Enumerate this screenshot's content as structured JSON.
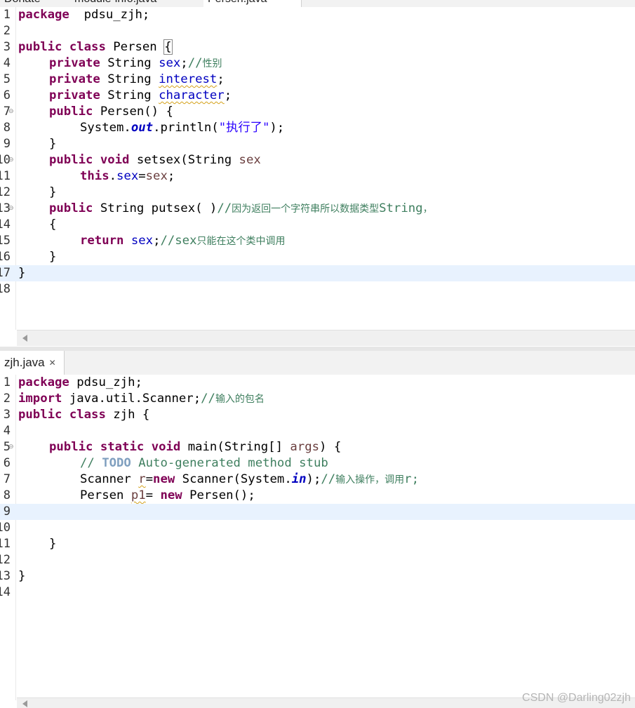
{
  "top_tabs": [
    "Donate",
    "module-info.java",
    "Persen.java"
  ],
  "pane1": {
    "lines": [
      {
        "n": "1",
        "segs": [
          [
            "kw",
            "package"
          ],
          [
            "",
            "  pdsu_zjh;"
          ]
        ]
      },
      {
        "n": "2",
        "segs": []
      },
      {
        "n": "3",
        "segs": [
          [
            "kw",
            "public"
          ],
          [
            "",
            " "
          ],
          [
            "kw",
            "class"
          ],
          [
            "",
            " Persen "
          ],
          [
            "box",
            "{"
          ]
        ]
      },
      {
        "n": "4",
        "segs": [
          [
            "",
            " "
          ],
          [
            "kw",
            "private"
          ],
          [
            "",
            " String "
          ],
          [
            "fld",
            "sex"
          ],
          [
            "",
            ";"
          ],
          [
            "cmt",
            "//"
          ],
          [
            "cmtcjk",
            "性别"
          ]
        ]
      },
      {
        "n": "5",
        "segs": [
          [
            "",
            " "
          ],
          [
            "kw",
            "private"
          ],
          [
            "",
            " String "
          ],
          [
            "fldw",
            "interest"
          ],
          [
            "",
            ";"
          ]
        ]
      },
      {
        "n": "6",
        "segs": [
          [
            "",
            " "
          ],
          [
            "kw",
            "private"
          ],
          [
            "",
            " String "
          ],
          [
            "fldw",
            "character"
          ],
          [
            "",
            ";"
          ]
        ]
      },
      {
        "n": "7",
        "fold": true,
        "segs": [
          [
            "",
            " "
          ],
          [
            "kw",
            "public"
          ],
          [
            "",
            " Persen() {"
          ]
        ]
      },
      {
        "n": "8",
        "segs": [
          [
            "",
            " System."
          ],
          [
            "sfld",
            "out"
          ],
          [
            "",
            ".println("
          ],
          [
            "str",
            "\"执行了\""
          ],
          [
            "",
            ");"
          ]
        ]
      },
      {
        "n": "9",
        "segs": [
          [
            "",
            " }"
          ]
        ]
      },
      {
        "n": "10",
        "fold": true,
        "segs": [
          [
            "",
            " "
          ],
          [
            "kw",
            "public"
          ],
          [
            "",
            " "
          ],
          [
            "kw",
            "void"
          ],
          [
            "",
            " setsex(String "
          ],
          [
            "var",
            "sex"
          ],
          [
            ") {"
          ]
        ]
      },
      {
        "n": "11",
        "segs": [
          [
            "",
            " "
          ],
          [
            "kw",
            "this"
          ],
          [
            "",
            "."
          ],
          [
            "fld",
            "sex"
          ],
          [
            "",
            "="
          ],
          [
            "var",
            "sex"
          ],
          [
            "",
            ";"
          ]
        ]
      },
      {
        "n": "12",
        "segs": [
          [
            "",
            " }"
          ]
        ]
      },
      {
        "n": "13",
        "fold": true,
        "segs": [
          [
            "",
            " "
          ],
          [
            "kw",
            "public"
          ],
          [
            "",
            " String putsex( )"
          ],
          [
            "cmt",
            "//"
          ],
          [
            "cmtcjk",
            "因为返回一个字符串所以数据类型"
          ],
          [
            "cmt",
            "String"
          ],
          [
            "cmtcjk",
            "，"
          ]
        ]
      },
      {
        "n": "14",
        "segs": [
          [
            "",
            " {"
          ]
        ]
      },
      {
        "n": "15",
        "segs": [
          [
            "",
            " "
          ],
          [
            "kw",
            "return"
          ],
          [
            "",
            " "
          ],
          [
            "fld",
            "sex"
          ],
          [
            "",
            ";"
          ],
          [
            "cmt",
            "//sex"
          ],
          [
            "cmtcjk",
            "只能在这个类中调用"
          ]
        ]
      },
      {
        "n": "16",
        "segs": [
          [
            "",
            " }"
          ]
        ]
      },
      {
        "n": "17",
        "current": true,
        "segs": [
          [
            "",
            "}"
          ]
        ]
      },
      {
        "n": "18",
        "segs": []
      }
    ]
  },
  "pane2": {
    "tab_label": "zjh.java",
    "close_glyph": "✕",
    "lines": [
      {
        "n": "1",
        "segs": [
          [
            "kw",
            "package"
          ],
          [
            "",
            " pdsu_zjh;"
          ]
        ]
      },
      {
        "n": "2",
        "segs": [
          [
            "kw",
            "import"
          ],
          [
            "",
            " java.util.Scanner;"
          ],
          [
            "cmt",
            "//"
          ],
          [
            "cmtcjk",
            "输入的包名"
          ]
        ]
      },
      {
        "n": "3",
        "segs": [
          [
            "kw",
            "public"
          ],
          [
            "",
            " "
          ],
          [
            "kw",
            "class"
          ],
          [
            "",
            " zjh {"
          ]
        ]
      },
      {
        "n": "4",
        "segs": []
      },
      {
        "n": "5",
        "fold": true,
        "segs": [
          [
            "",
            " "
          ],
          [
            "kw",
            "public"
          ],
          [
            "",
            " "
          ],
          [
            "kw",
            "static"
          ],
          [
            "",
            " "
          ],
          [
            "kw",
            "void"
          ],
          [
            "",
            " main(String[] "
          ],
          [
            "var",
            "args"
          ],
          [
            "",
            ") {"
          ]
        ]
      },
      {
        "n": "6",
        "segs": [
          [
            "",
            " "
          ],
          [
            "cmt",
            "// "
          ],
          [
            "todo",
            "TODO"
          ],
          [
            "cmt",
            " Auto-generated method stub"
          ]
        ]
      },
      {
        "n": "7",
        "segs": [
          [
            "",
            " Scanner "
          ],
          [
            "varw",
            "r"
          ],
          [
            "",
            "="
          ],
          [
            "kw",
            "new"
          ],
          [
            "",
            " Scanner(System."
          ],
          [
            "sfld",
            "in"
          ],
          [
            "",
            ");"
          ],
          [
            "cmt",
            "//"
          ],
          [
            "cmtcjk",
            "输入操作，调用"
          ],
          [
            "cmt",
            "r;"
          ]
        ]
      },
      {
        "n": "8",
        "segs": [
          [
            "",
            " Persen "
          ],
          [
            "varw",
            "p1"
          ],
          [
            "",
            "= "
          ],
          [
            "kw",
            "new"
          ],
          [
            "",
            " Persen();"
          ]
        ]
      },
      {
        "n": "9",
        "current": true,
        "segs": []
      },
      {
        "n": "10",
        "segs": []
      },
      {
        "n": "11",
        "segs": [
          [
            "",
            " }"
          ]
        ]
      },
      {
        "n": "12",
        "segs": []
      },
      {
        "n": "13",
        "segs": [
          [
            "",
            "}"
          ]
        ]
      },
      {
        "n": "14",
        "segs": []
      }
    ]
  },
  "watermark": "CSDN @Darling02zjh"
}
